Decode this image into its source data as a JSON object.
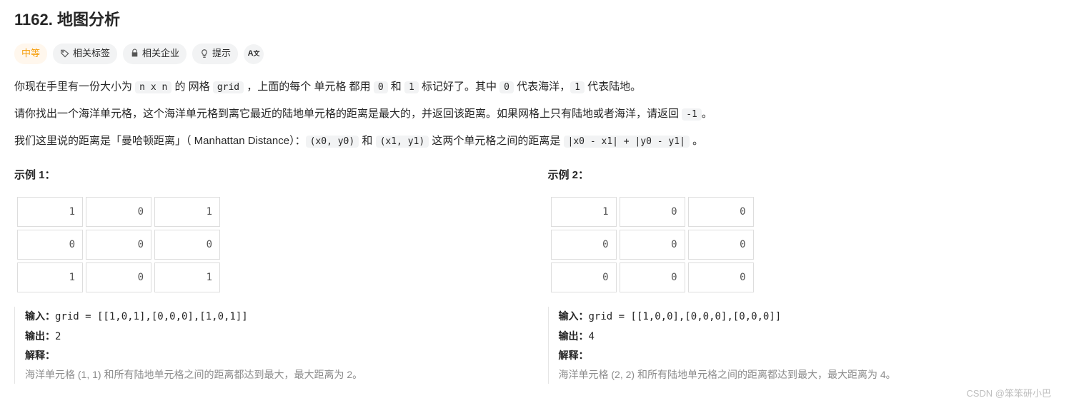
{
  "title": "1162. 地图分析",
  "meta": {
    "difficulty": "中等",
    "tags": "相关标签",
    "companies": "相关企业",
    "hint": "提示",
    "translate": "Aㅊ"
  },
  "desc": {
    "p1a": "你现在手里有一份大小为 ",
    "p1_code1": "n x n",
    "p1b": " 的 网格 ",
    "p1_code2": "grid",
    "p1c": " ，上面的每个 单元格 都用 ",
    "p1_code3": "0",
    "p1d": " 和 ",
    "p1_code4": "1",
    "p1e": " 标记好了。其中 ",
    "p1_code5": "0",
    "p1f": " 代表海洋，",
    "p1_code6": "1",
    "p1g": " 代表陆地。",
    "p2a": "请你找出一个海洋单元格，这个海洋单元格到离它最近的陆地单元格的距离是最大的，并返回该距离。如果网格上只有陆地或者海洋，请返回 ",
    "p2_code1": "-1",
    "p2b": "。",
    "p3a": "我们这里说的距离是「曼哈顿距离」（ Manhattan Distance）：",
    "p3_code1": "(x0, y0)",
    "p3b": " 和 ",
    "p3_code2": "(x1, y1)",
    "p3c": " 这两个单元格之间的距离是 ",
    "p3_code3": "|x0 - x1| + |y0 - y1|",
    "p3d": " 。"
  },
  "ex1": {
    "title": "示例 1：",
    "grid": [
      [
        "1",
        "0",
        "1"
      ],
      [
        "0",
        "0",
        "0"
      ],
      [
        "1",
        "0",
        "1"
      ]
    ],
    "input_label": "输入：",
    "input_val": "grid = [[1,0,1],[0,0,0],[1,0,1]]",
    "output_label": "输出：",
    "output_val": "2",
    "explain_label": "解释：",
    "explain_val": "海洋单元格 (1, 1) 和所有陆地单元格之间的距离都达到最大，最大距离为 2。"
  },
  "ex2": {
    "title": "示例 2：",
    "grid": [
      [
        "1",
        "0",
        "0"
      ],
      [
        "0",
        "0",
        "0"
      ],
      [
        "0",
        "0",
        "0"
      ]
    ],
    "input_label": "输入：",
    "input_val": "grid = [[1,0,0],[0,0,0],[0,0,0]]",
    "output_label": "输出：",
    "output_val": "4",
    "explain_label": "解释：",
    "explain_val": "海洋单元格 (2, 2) 和所有陆地单元格之间的距离都达到最大，最大距离为 4。"
  },
  "watermark": "CSDN @笨笨研小巴"
}
